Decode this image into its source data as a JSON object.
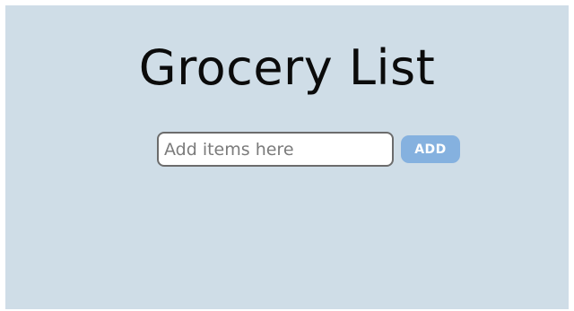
{
  "app": {
    "title": "Grocery List",
    "background_color": "#cfdde7"
  },
  "add_form": {
    "input_value": "",
    "input_placeholder": "Add items here",
    "add_button_label": "ADD",
    "add_button_color": "#85b1df"
  }
}
